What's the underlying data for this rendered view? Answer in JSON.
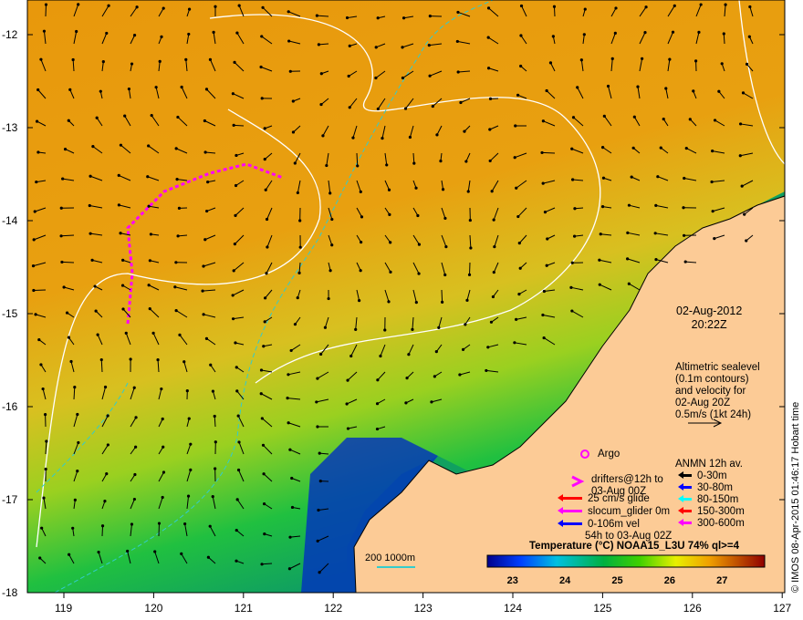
{
  "map": {
    "lon_ticks": [
      "119",
      "120",
      "121",
      "122",
      "123",
      "124",
      "125",
      "126",
      "127"
    ],
    "lat_ticks": [
      "-12",
      "-13",
      "-14",
      "-15",
      "-16",
      "-17",
      "-18"
    ],
    "date": "02-Aug-2012",
    "time": "20:22Z",
    "altimetry_note": [
      "Altimetric sealevel",
      "(0.1m contours)",
      "and velocity for",
      "02-Aug 20Z",
      "0.5m/s (1kt 24h)"
    ],
    "credit": "© IMOS 08-Apr-2015 01:46:17 Hobart time",
    "depth_contour_label": "200  1000m",
    "colors": {
      "land": "#fccb96",
      "warm": "#e8980c",
      "cold": "#00008c",
      "contour": "#ffffff",
      "isobath": "#33cccc"
    }
  },
  "legend": {
    "argo": "Argo",
    "drifters": [
      "drifters@12h to",
      "03-Aug 00Z"
    ],
    "glide": "25 cm/s glide",
    "slocum": "slocum_glider 0m",
    "vel": [
      "0-106m vel",
      "54h to 03-Aug 02Z"
    ],
    "anmn_title": "ANMN 12h av.",
    "anmn": [
      {
        "label": "0-30m",
        "color": "#000000"
      },
      {
        "label": "30-80m",
        "color": "#0000ff"
      },
      {
        "label": "80-150m",
        "color": "#00ffff"
      },
      {
        "label": "150-300m",
        "color": "#ff0000"
      },
      {
        "label": "300-600m",
        "color": "#ff00ff"
      }
    ]
  },
  "colorbar": {
    "title": "Temperature (°C) NOAA15_L3U 74% ql>=4",
    "ticks": [
      "23",
      "24",
      "25",
      "26",
      "27"
    ],
    "range": [
      22.5,
      27.8
    ]
  }
}
